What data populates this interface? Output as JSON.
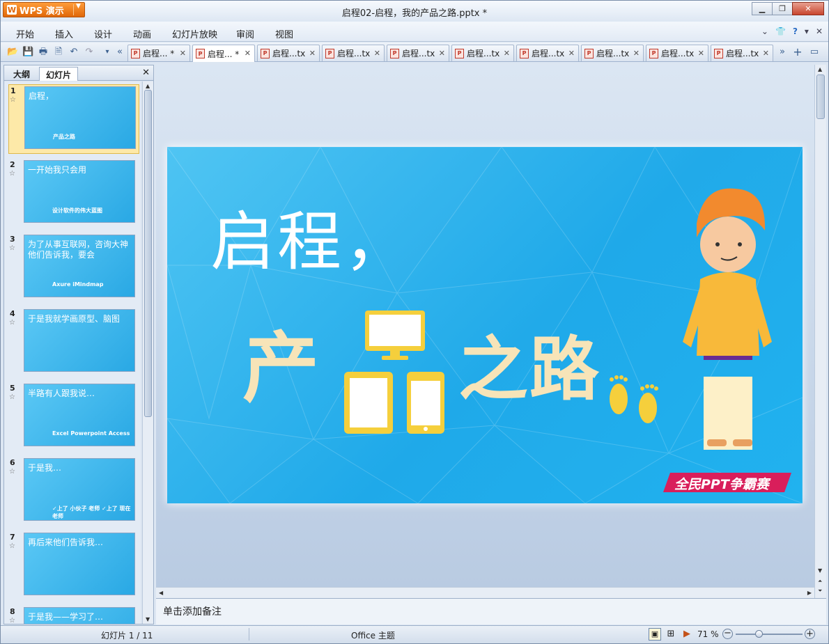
{
  "app": {
    "button_label": "WPS 演示",
    "logo_glyph": "W"
  },
  "window": {
    "title": "启程02-启程，我的产品之路.pptx *"
  },
  "menu": [
    "开始",
    "插入",
    "设计",
    "动画",
    "幻灯片放映",
    "审阅",
    "视图"
  ],
  "doc_tabs": [
    {
      "label": "启程... *",
      "active": false
    },
    {
      "label": "启程... *",
      "active": true
    },
    {
      "label": "启程...tx",
      "active": false
    },
    {
      "label": "启程...tx",
      "active": false
    },
    {
      "label": "启程...tx",
      "active": false
    },
    {
      "label": "启程...tx",
      "active": false
    },
    {
      "label": "启程...tx",
      "active": false
    },
    {
      "label": "启程...tx",
      "active": false
    },
    {
      "label": "启程...tx",
      "active": false
    },
    {
      "label": "启程...tx",
      "active": false
    }
  ],
  "panel": {
    "tab_outline": "大纲",
    "tab_slides": "幻灯片"
  },
  "thumbnails": [
    {
      "num": "1",
      "text": "启程，",
      "sub": "产品之路"
    },
    {
      "num": "2",
      "text": "一开始我只会用",
      "sub": "设计软件的伟大蓝图"
    },
    {
      "num": "3",
      "text": "为了从事互联网，咨询大神他们告诉我，要会",
      "sub": "Axure     iMindmap"
    },
    {
      "num": "4",
      "text": "于是我就学画原型、脑图",
      "sub": ""
    },
    {
      "num": "5",
      "text": "半路有人跟我说…",
      "sub": "Excel    Powerpoint Access"
    },
    {
      "num": "6",
      "text": "于是我…",
      "sub": "✓上了 小伙子 老师  ✓上了 现在 老师"
    },
    {
      "num": "7",
      "text": "再后来他们告诉我…",
      "sub": ""
    },
    {
      "num": "8",
      "text": "于是我——学习了…",
      "sub": ""
    }
  ],
  "slide": {
    "title": "启程，",
    "subtitle_left": "产",
    "subtitle_right": "之路",
    "badge": "全民PPT争霸赛"
  },
  "notes": {
    "placeholder": "单击添加备注"
  },
  "status": {
    "slide_counter": "幻灯片 1 / 11",
    "theme": "Office 主题",
    "zoom": "71 %",
    "zoom_level": 0.71
  },
  "colors": {
    "accent": "#e06708",
    "slide_bg": "#29a8e4",
    "tab_icon": "#c0392b"
  }
}
